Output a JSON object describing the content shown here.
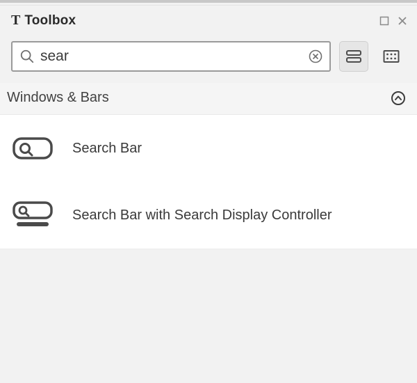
{
  "header": {
    "title": "Toolbox"
  },
  "search": {
    "value": "sear",
    "placeholder": ""
  },
  "section": {
    "title": "Windows & Bars"
  },
  "results": [
    {
      "label": "Search Bar",
      "icon": "searchbar"
    },
    {
      "label": "Search Bar with Search Display Controller",
      "icon": "searchbar-controller"
    }
  ]
}
